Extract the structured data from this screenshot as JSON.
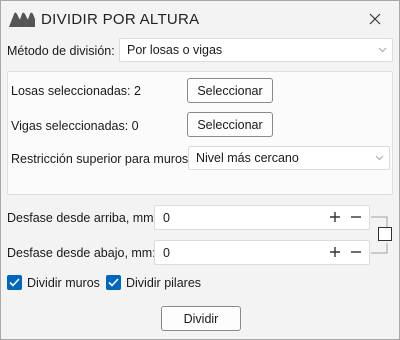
{
  "window": {
    "title": "DIVIDIR POR ALTURA"
  },
  "method": {
    "label": "Método de división:",
    "value": "Por losas o vigas"
  },
  "selection": {
    "slabs_label": "Losas seleccionadas: 2",
    "slabs_button": "Seleccionar",
    "beams_label": "Vigas seleccionadas: 0",
    "beams_button": "Seleccionar",
    "restriction_label": "Restricción superior para muros:",
    "restriction_value": "Nivel más cercano"
  },
  "offsets": {
    "top_label": "Desfase desde arriba, mm:",
    "top_value": "0",
    "bottom_label": "Desfase desde abajo, mm:",
    "bottom_value": "0",
    "link_checked": false
  },
  "options": {
    "split_walls_label": "Dividir muros",
    "split_walls_checked": true,
    "split_columns_label": "Dividir pilares",
    "split_columns_checked": true
  },
  "actions": {
    "split_button": "Dividir"
  },
  "colors": {
    "accent": "#0067c0",
    "logo": "#555555"
  }
}
